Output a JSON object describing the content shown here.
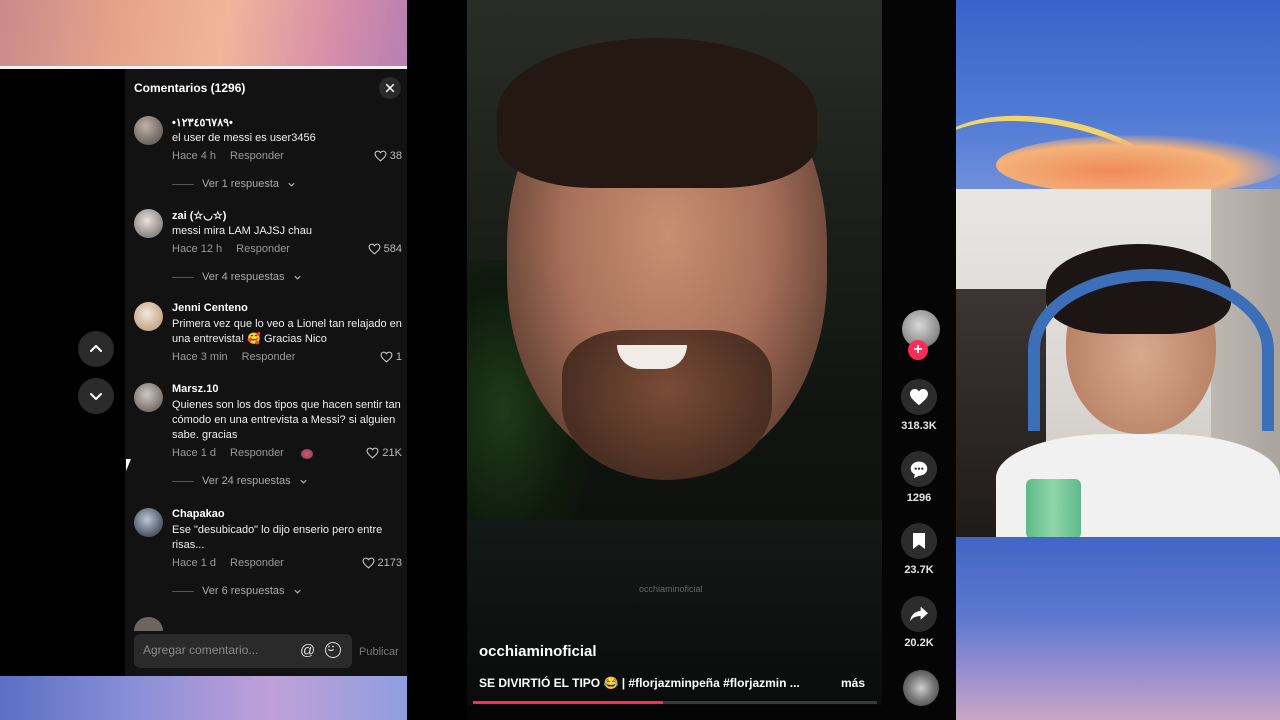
{
  "comments_panel": {
    "title": "Comentarios (1296)",
    "input_placeholder": "Agregar comentario...",
    "publish_label": "Publicar",
    "comments": [
      {
        "name": "•١٢٣٤٥٦٧٨٩•",
        "text": "el user de messi es user3456",
        "time": "Hace 4 h",
        "reply": "Responder",
        "likes": "38",
        "replies": "Ver 1 respuesta"
      },
      {
        "name": "zai (☆◡☆)",
        "text": "messi mira LAM JAJSJ chau",
        "time": "Hace 12 h",
        "reply": "Responder",
        "likes": "584",
        "replies": "Ver 4 respuestas"
      },
      {
        "name": "Jenni Centeno",
        "text": "Primera vez que lo veo a Lionel tan relajado en una entrevista! 🥰 Gracias Nico",
        "time": "Hace 3 min",
        "reply": "Responder",
        "likes": "1"
      },
      {
        "name": "Marsz.10",
        "text": "Quienes son los dos tipos que hacen sentir tan cómodo en una entrevista a Messi? si alguien sabe. gracias",
        "time": "Hace 1 d",
        "reply": "Responder",
        "likes": "21K",
        "replies": "Ver 24 respuestas"
      },
      {
        "name": "Chapakao",
        "text": "Ese \"desubicado\" lo dijo enserio pero entre risas...",
        "time": "Hace 1 d",
        "reply": "Responder",
        "likes": "2173",
        "replies": "Ver 6 respuestas"
      }
    ]
  },
  "video": {
    "author": "occhiaminoficial",
    "watermark": "occhiaminoficial",
    "caption": "SE DIVIRTIÓ EL TIPO 😂 | #florjazminpeña #florjazmin ...",
    "more_label": "más",
    "progress": 0.47,
    "actions": {
      "likes": "318.3K",
      "comments": "1296",
      "saves": "23.7K",
      "shares": "20.2K"
    }
  },
  "colors": {
    "accent": "#fe2c55",
    "panel_bg": "#121212"
  }
}
